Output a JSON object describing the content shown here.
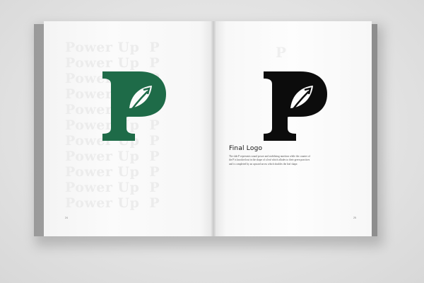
{
  "spread": {
    "ghost_word": "Power Up",
    "ghost_letter": "P",
    "ghost_rows": 11
  },
  "logo": {
    "left_color": "#1e6b48",
    "right_color": "#0c0c0c",
    "icon": "leaf-p-logo-icon"
  },
  "caption": {
    "heading": "Final Logo",
    "body": "The slab P represents sound power and stabilizing nutrition while the counter of the P is knocked out in the shape of a leaf which alludes to their green practices and is completed by an upward arrow which doubles the leaf shape."
  },
  "folios": {
    "left": "24",
    "right": "25"
  }
}
